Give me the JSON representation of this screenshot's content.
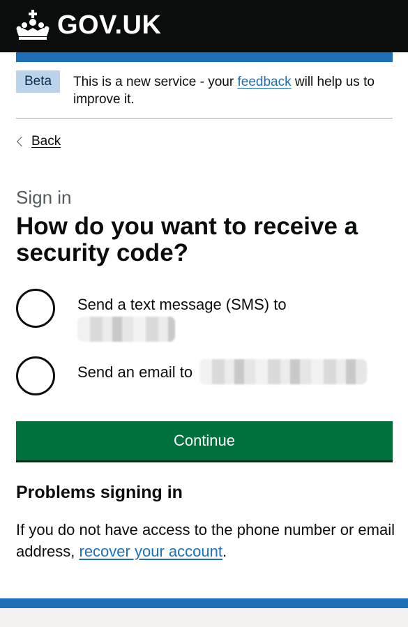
{
  "header": {
    "logo_text": "GOV.UK",
    "brand_color": "#0b0c0c",
    "accent_color": "#1d70b8"
  },
  "phase_banner": {
    "tag": "Beta",
    "text_before": "This is a new service - your ",
    "link_text": "feedback",
    "text_after": " will help us to improve it."
  },
  "back_link": {
    "label": "Back"
  },
  "caption": "Sign in",
  "heading": "How do you want to receive a security code?",
  "options": [
    {
      "label": "Send a text message (SMS) to",
      "value_redacted": true
    },
    {
      "label": "Send an email to",
      "value_redacted": true
    }
  ],
  "continue_button": {
    "label": "Continue",
    "color": "#00703c"
  },
  "problems": {
    "heading": "Problems signing in",
    "text_before": "If you do not have access to the phone number or email address, ",
    "link_text": "recover your account",
    "text_after": "."
  }
}
